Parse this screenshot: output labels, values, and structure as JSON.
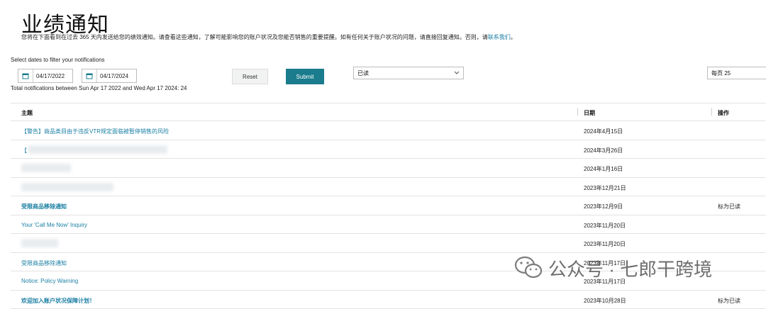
{
  "page": {
    "title": "业绩通知",
    "description_pre": "您将在下面看到在过去 365 天内发送给您的绩效通知。请查看这些通知，了解可能影响您的账户状况及您能否销售的重要提醒。如有任何关于账户状况的问题，请直接回复通知。否则，请",
    "description_link": "联系我们",
    "description_post": "。"
  },
  "filter": {
    "label": "Select dates to filter your notifications",
    "start_date": "04/17/2022",
    "end_date": "04/17/2024",
    "reset_label": "Reset",
    "submit_label": "Submit",
    "status_select": "已读",
    "per_page_select": "每页 25",
    "total_text": "Total notifications between Sun Apr 17 2022 and Wed Apr 17 2024: 24"
  },
  "table": {
    "headers": {
      "subject": "主题",
      "date": "日期",
      "action": "操作"
    },
    "rows": [
      {
        "subject": "【警告】商品类目由于违反VTR规定面临被暂停销售的风险",
        "date": "2024年4月15日",
        "action": "",
        "bold": false
      },
      {
        "subject": "【",
        "date": "2024年3月26日",
        "action": "",
        "bold": false
      },
      {
        "subject": "",
        "date": "2024年1月16日",
        "action": "",
        "bold": false
      },
      {
        "subject": "",
        "date": "2023年12月21日",
        "action": "",
        "bold": false
      },
      {
        "subject": "受限商品移除通知",
        "date": "2023年12月9日",
        "action": "标为已读",
        "bold": true
      },
      {
        "subject": "Your 'Call Me Now' Inquiry",
        "date": "2023年11月20日",
        "action": "",
        "bold": false
      },
      {
        "subject": "",
        "date": "2023年11月20日",
        "action": "",
        "bold": false
      },
      {
        "subject": "受限商品移除通知",
        "date": "2023年11月17日",
        "action": "",
        "bold": false
      },
      {
        "subject": "Notice: Policy Warning",
        "date": "2023年11月17日",
        "action": "",
        "bold": false
      },
      {
        "subject": "欢迎加入账户状况保障计划！",
        "date": "2023年10月28日",
        "action": "标为已读",
        "bold": true
      }
    ]
  },
  "watermark": {
    "text": "公众号 · 七郎干跨境"
  },
  "colors": {
    "accent": "#1a7c8c",
    "link": "#1a7fa3"
  }
}
